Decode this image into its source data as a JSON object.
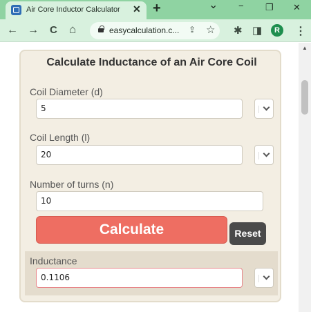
{
  "browser": {
    "tab_title": "Air Core Inductor Calculator",
    "tab_close": "✕",
    "new_tab": "+",
    "url": "easycalculation.c...",
    "profile_initial": "R",
    "window_controls": {
      "collapse": "⌄",
      "minimize": "−",
      "restore": "❐",
      "close": "✕"
    },
    "icons": {
      "back": "←",
      "forward": "→",
      "reload": "C",
      "home": "⌂",
      "share": "⇪",
      "star": "☆",
      "extensions": "✱",
      "sidepanel": "◨",
      "menu": "⋮"
    }
  },
  "calculator": {
    "title": "Calculate Inductance of an Air Core Coil",
    "fields": [
      {
        "label": "Coil Diameter (d)",
        "value": "5"
      },
      {
        "label": "Coil Length (l)",
        "value": "20"
      },
      {
        "label": "Number of turns (n)",
        "value": "10"
      }
    ],
    "calculate_label": "Calculate",
    "reset_label": "Reset",
    "result": {
      "label": "Inductance",
      "value": "0.1106"
    }
  },
  "colors": {
    "tabstrip": "#8fd3a2",
    "toolbar": "#d8f1de",
    "panel": "#f3eee3",
    "calculate": "#ee6e62",
    "reset": "#4a4a4a"
  }
}
